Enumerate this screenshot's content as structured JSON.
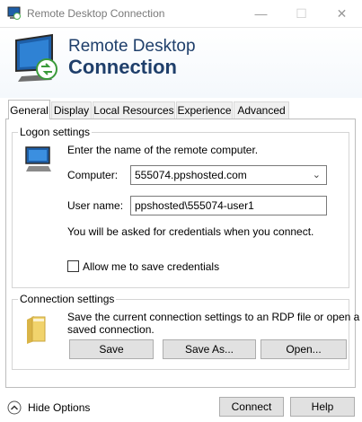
{
  "window": {
    "title": "Remote Desktop Connection",
    "controls": {
      "minimize": "—",
      "maximize": "☐",
      "close": "✕"
    }
  },
  "banner": {
    "line1": "Remote Desktop",
    "line2": "Connection"
  },
  "tabs": [
    {
      "label": "General",
      "active": true
    },
    {
      "label": "Display",
      "active": false
    },
    {
      "label": "Local Resources",
      "active": false
    },
    {
      "label": "Experience",
      "active": false
    },
    {
      "label": "Advanced",
      "active": false
    }
  ],
  "logon": {
    "title": "Logon settings",
    "instruction": "Enter the name of the remote computer.",
    "computer_label": "Computer:",
    "computer_value": "555074.ppshosted.com",
    "username_label": "User name:",
    "username_value": "ppshosted\\555074-user1",
    "credentials_note": "You will be asked for credentials when you connect.",
    "save_credentials_label": "Allow me to save credentials",
    "save_credentials_checked": false
  },
  "connection": {
    "title": "Connection settings",
    "description_line1": "Save the current connection settings to an RDP file or open a",
    "description_line2": "saved connection.",
    "save_button": "Save",
    "save_as_button": "Save As...",
    "open_button": "Open..."
  },
  "footer": {
    "hide_options": "Hide Options",
    "connect_button": "Connect",
    "help_button": "Help"
  },
  "icons": {
    "app": "remote-desktop-icon",
    "computer": "computer-icon",
    "folder": "folder-icon",
    "hide_options": "chevron-up-circle-icon"
  },
  "colors": {
    "accent": "#1f3f6b",
    "folder": "#f1d36c"
  }
}
